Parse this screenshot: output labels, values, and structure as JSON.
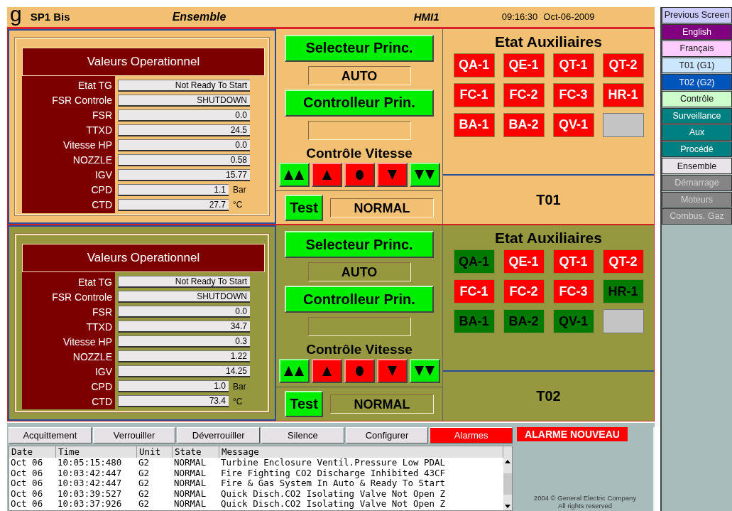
{
  "header": {
    "logo": "g",
    "site": "SP1 Bis",
    "screen": "Ensemble",
    "station": "HMI1",
    "time": "09:16:30",
    "date": "Oct-06-2009"
  },
  "units": [
    {
      "name": "T01",
      "color": "#f2c073",
      "values_title": "Valeurs Operationnel",
      "values": [
        {
          "label": "Etat TG",
          "value": "Not Ready To Start"
        },
        {
          "label": "FSR Controle",
          "value": "SHUTDOWN"
        },
        {
          "label": "FSR",
          "value": "0.0"
        },
        {
          "label": "TTXD",
          "value": "24.5"
        },
        {
          "label": "Vitesse HP",
          "value": "0.0"
        },
        {
          "label": "NOZZLE",
          "value": "0.58"
        },
        {
          "label": "IGV",
          "value": "15.77"
        },
        {
          "label": "CPD",
          "value": "1.1",
          "unit": "Bar"
        },
        {
          "label": "CTD",
          "value": "27.7",
          "unit": "°C"
        }
      ],
      "selector": {
        "label": "Selecteur Princ.",
        "status": "AUTO"
      },
      "controller": {
        "label": "Controlleur Prin."
      },
      "speed": {
        "title": "Contrôle Vitesse",
        "buttons": [
          {
            "kind": "fast-up",
            "color": "#00ee00"
          },
          {
            "kind": "up",
            "color": "#ff0000"
          },
          {
            "kind": "stop",
            "color": "#ff0000"
          },
          {
            "kind": "down",
            "color": "#ff0000"
          },
          {
            "kind": "fast-down",
            "color": "#00ee00"
          }
        ]
      },
      "test": {
        "label": "Test",
        "status": "NORMAL"
      },
      "aux": {
        "title": "Etat Auxiliaires",
        "tiles": [
          {
            "label": "QA-1",
            "kind": "alarm"
          },
          {
            "label": "QE-1",
            "kind": "alarm"
          },
          {
            "label": "QT-1",
            "kind": "alarm"
          },
          {
            "label": "QT-2",
            "kind": "alarm"
          },
          {
            "label": "FC-1",
            "kind": "alarm"
          },
          {
            "label": "FC-2",
            "kind": "alarm"
          },
          {
            "label": "FC-3",
            "kind": "alarm"
          },
          {
            "label": "HR-1",
            "kind": "alarm"
          },
          {
            "label": "BA-1",
            "kind": "alarm"
          },
          {
            "label": "BA-2",
            "kind": "alarm"
          },
          {
            "label": "QV-1",
            "kind": "alarm"
          },
          {
            "kind": "blank"
          }
        ]
      }
    },
    {
      "name": "T02",
      "color": "#95983e",
      "values_title": "Valeurs Operationnel",
      "values": [
        {
          "label": "Etat TG",
          "value": "Not Ready To Start"
        },
        {
          "label": "FSR Controle",
          "value": "SHUTDOWN"
        },
        {
          "label": "FSR",
          "value": "0.0"
        },
        {
          "label": "TTXD",
          "value": "34.7"
        },
        {
          "label": "Vitesse HP",
          "value": "0.3"
        },
        {
          "label": "NOZZLE",
          "value": "1.22"
        },
        {
          "label": "IGV",
          "value": "14.25"
        },
        {
          "label": "CPD",
          "value": "1.0",
          "unit": "Bar"
        },
        {
          "label": "CTD",
          "value": "73.4",
          "unit": "°C"
        }
      ],
      "selector": {
        "label": "Selecteur Princ.",
        "status": "AUTO"
      },
      "controller": {
        "label": "Controlleur Prin."
      },
      "speed": {
        "title": "Contrôle Vitesse",
        "buttons": [
          {
            "kind": "fast-up",
            "color": "#00ee00"
          },
          {
            "kind": "up",
            "color": "#ff0000"
          },
          {
            "kind": "stop",
            "color": "#ff0000"
          },
          {
            "kind": "down",
            "color": "#ff0000"
          },
          {
            "kind": "fast-down",
            "color": "#00ee00"
          }
        ]
      },
      "test": {
        "label": "Test",
        "status": "NORMAL"
      },
      "aux": {
        "title": "Etat Auxiliaires",
        "tiles": [
          {
            "label": "QA-1",
            "kind": "normal"
          },
          {
            "label": "QE-1",
            "kind": "alarm"
          },
          {
            "label": "QT-1",
            "kind": "alarm"
          },
          {
            "label": "QT-2",
            "kind": "alarm"
          },
          {
            "label": "FC-1",
            "kind": "alarm"
          },
          {
            "label": "FC-2",
            "kind": "alarm"
          },
          {
            "label": "FC-3",
            "kind": "alarm"
          },
          {
            "label": "HR-1",
            "kind": "normal"
          },
          {
            "label": "BA-1",
            "kind": "normal"
          },
          {
            "label": "BA-2",
            "kind": "normal"
          },
          {
            "label": "QV-1",
            "kind": "normal"
          },
          {
            "kind": "blank"
          }
        ]
      }
    }
  ],
  "alarm_buttons": [
    {
      "label": "Acquittement",
      "selected": false
    },
    {
      "label": "Verrouiller",
      "selected": false
    },
    {
      "label": "Déverrouiller",
      "selected": false
    },
    {
      "label": "Silence",
      "selected": false
    },
    {
      "label": "Configurer",
      "selected": false
    },
    {
      "label": "Alarmes",
      "selected": true
    }
  ],
  "alarm_table": {
    "columns": [
      "Date",
      "Time",
      "Unit",
      "State",
      "Message"
    ],
    "rows": [
      [
        "Oct 06",
        "10:05:15:480",
        "G2",
        "NORMAL",
        "Turbine Enclosure Ventil.Pressure Low PDAL"
      ],
      [
        "Oct 06",
        "10:03:42:447",
        "G2",
        "NORMAL",
        "Fire Fighting CO2 Discharge Inhibited 43CF"
      ],
      [
        "Oct 06",
        "10:03:42:447",
        "G2",
        "NORMAL",
        "Fire & Gas System In Auto & Ready To Start"
      ],
      [
        "Oct 06",
        "10:03:39:527",
        "G2",
        "NORMAL",
        "Quick Disch.CO2 Isolating Valve Not Open Z"
      ],
      [
        "Oct 06",
        "10:03:37:926",
        "G2",
        "NORMAL",
        "Quick Disch.CO2 Isolating Valve Not Open Z"
      ]
    ]
  },
  "new_alarm": "ALARME NOUVEAU",
  "copyright": [
    "2004 © General Electric Company",
    "All rights reserved"
  ],
  "nav": [
    {
      "label": "Previous Screen",
      "color": "#ccccff"
    },
    {
      "label": "English",
      "color": "#800080"
    },
    {
      "label": "Français",
      "color": "#ffccff"
    },
    {
      "label": "T01 (G1)",
      "color": "#cce6ff"
    },
    {
      "label": "T02 (G2)",
      "color": "#0055bb"
    },
    {
      "label": "Contrôle",
      "color": "#ccffcc"
    },
    {
      "label": "Surveillance",
      "color": "#008080"
    },
    {
      "label": "Aux",
      "color": "#008080"
    },
    {
      "label": "Procédé",
      "color": "#008080"
    },
    {
      "label": "Ensemble",
      "color": "#e8e4ea"
    },
    {
      "label": "Démarrage",
      "color": "#858585"
    },
    {
      "label": "Moteurs",
      "color": "#858585"
    },
    {
      "label": "Combus. Gaz",
      "color": "#858585"
    }
  ]
}
